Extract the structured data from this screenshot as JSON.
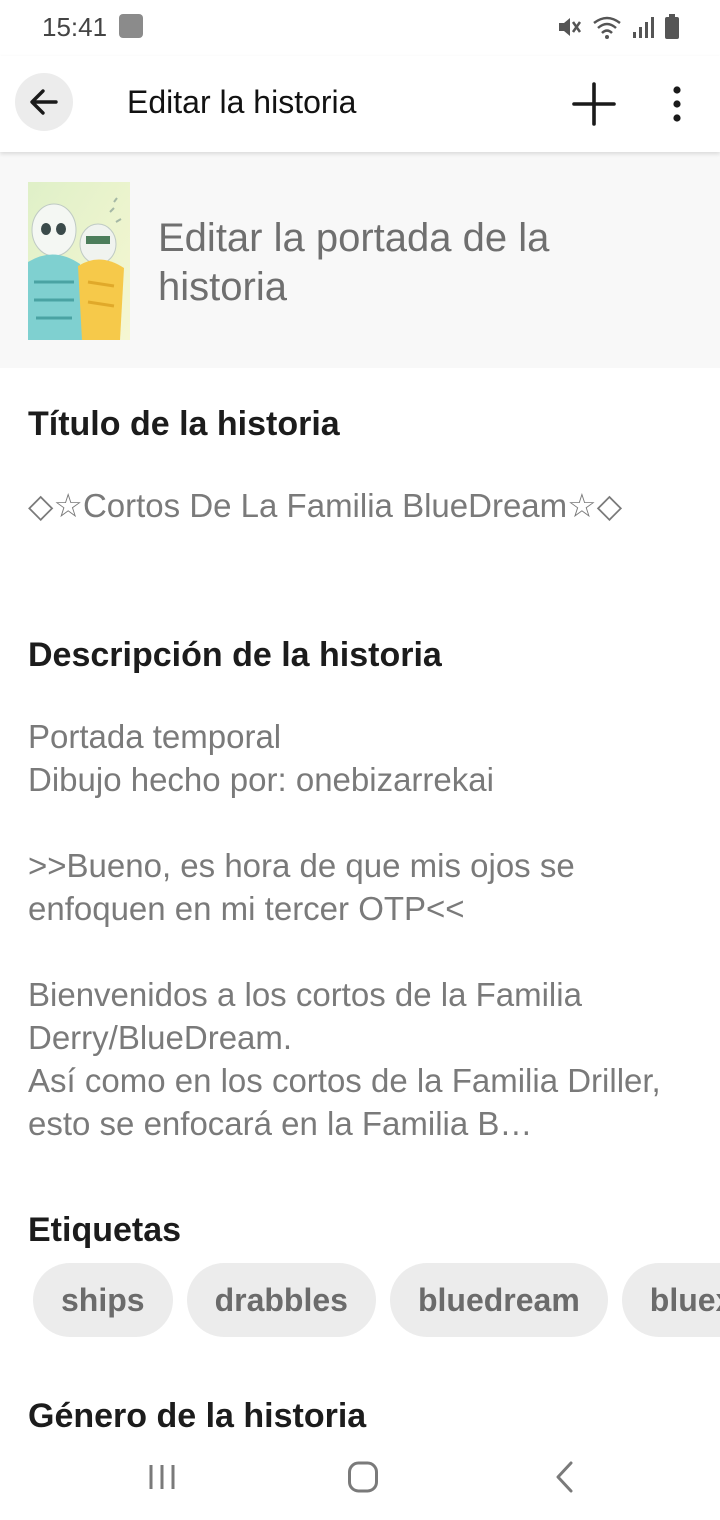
{
  "status_bar": {
    "time": "15:41",
    "icons": [
      "app-notification-icon",
      "mute-icon",
      "wifi-icon",
      "signal-icon",
      "battery-icon"
    ]
  },
  "app_bar": {
    "title": "Editar la historia",
    "back_icon": "arrow-left-icon",
    "add_icon": "plus-icon",
    "more_icon": "more-vertical-icon"
  },
  "cover": {
    "label": "Editar la portada de la historia"
  },
  "title_section": {
    "heading": "Título de la historia",
    "value": "◇☆Cortos De La Familia BlueDream☆◇"
  },
  "description_section": {
    "heading": "Descripción de la historia",
    "value": "Portada temporal\nDibujo hecho por: onebizarrekai\n\n>>Bueno, es hora de que mis ojos se enfoquen en mi tercer OTP<<\n\nBienvenidos a los cortos de la Familia Derry/BlueDream.\nAsí como en los cortos de la Familia Driller, esto se enfocará en la Familia B…"
  },
  "tags_section": {
    "heading": "Etiquetas",
    "tags": [
      "ships",
      "drabbles",
      "bluedream",
      "bluex"
    ]
  },
  "genre_section": {
    "heading": "Género de la historia"
  },
  "nav_bar": {
    "icons": [
      "recents-icon",
      "home-icon",
      "back-icon"
    ]
  },
  "colors": {
    "chip_bg": "#ececec",
    "chip_text": "#6b6b6b",
    "muted_text": "#7a7a7a",
    "cover_row_bg": "#f8f8f8"
  }
}
